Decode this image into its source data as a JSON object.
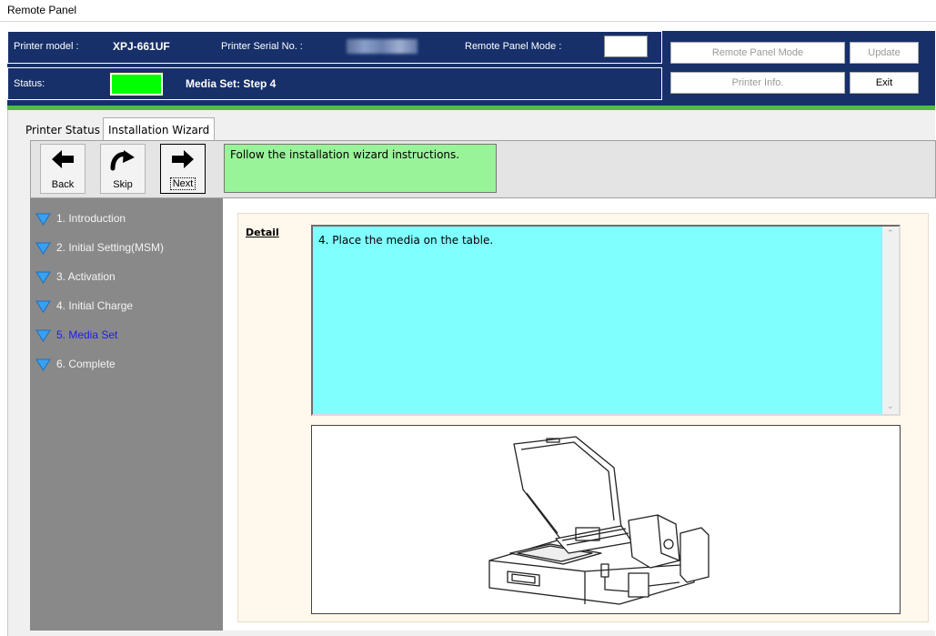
{
  "window": {
    "title": "Remote Panel"
  },
  "info": {
    "printer_model_label": "Printer model :",
    "printer_model_value": "XPJ-661UF",
    "serial_label": "Printer Serial No. :",
    "remote_mode_label": "Remote Panel Mode :",
    "status_label": "Status:",
    "status_value": "Media Set: Step 4",
    "status_color": "#00ff00"
  },
  "buttons": {
    "remote_panel_mode": "Remote Panel Mode",
    "update": "Update",
    "printer_info": "Printer Info.",
    "exit": "Exit"
  },
  "tabs": [
    {
      "label": "Printer Status"
    },
    {
      "label": "Installation Wizard"
    }
  ],
  "toolbar": {
    "back": "Back",
    "skip": "Skip",
    "next": "Next",
    "instruction": "Follow the installation wizard instructions."
  },
  "steps": [
    {
      "label": "1. Introduction"
    },
    {
      "label": "2. Initial Setting(MSM)"
    },
    {
      "label": "3. Activation"
    },
    {
      "label": "4. Initial Charge"
    },
    {
      "label": "5. Media Set",
      "current": true
    },
    {
      "label": "6. Complete"
    }
  ],
  "detail": {
    "label": "Detail",
    "text": "4. Place the media on the table."
  },
  "colors": {
    "header_bg": "#17306a",
    "accent_stripe": "#56b848",
    "instruction_bg": "#99f399",
    "detail_bg": "#80ffff",
    "sidebar_bg": "#898989",
    "current_step": "#1e1ee8",
    "step_icon": "#3aa0f0"
  }
}
